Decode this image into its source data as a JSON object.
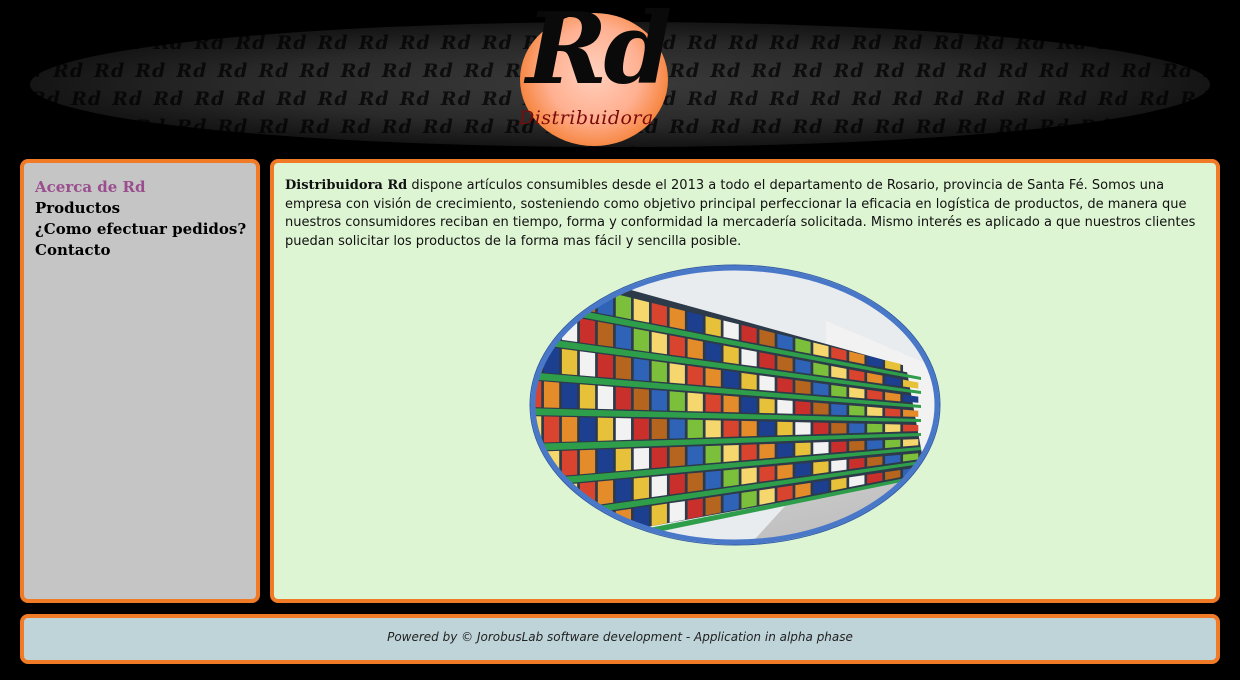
{
  "header": {
    "logo_main": "Rd",
    "logo_sub": "Distribuidora",
    "pattern_word": "Rd"
  },
  "sidebar": {
    "items": [
      {
        "label": "Acerca de Rd",
        "active": true
      },
      {
        "label": "Productos",
        "active": false
      },
      {
        "label": "¿Como efectuar pedidos?",
        "active": false
      },
      {
        "label": "Contacto",
        "active": false
      }
    ]
  },
  "main": {
    "intro_bold": "Distribuidora Rd",
    "intro_text": " dispone artículos consumibles desde el 2013 a todo el departamento de Rosario, provincia de Santa Fé. Somos una empresa con visión de crecimiento, sosteniendo como objetivo principal perfeccionar la eficacia en logística de productos, de manera que nuestros consumidores reciban en tiempo, forma y conformidad la mercadería solicitada. Mismo interés es aplicado a que nuestros clientes puedan solicitar los productos de la forma mas fácil y sencilla posible."
  },
  "footer": {
    "text": "Powered by © JorobusLab software development - Application in alpha phase"
  },
  "colors": {
    "border_orange": "#f07a26",
    "sidebar_bg": "#c5c5c5",
    "content_bg": "#def5d4",
    "footer_bg": "#bfd4d9",
    "active_link": "#9a4e8e",
    "photo_frame": "#4a78c8"
  }
}
